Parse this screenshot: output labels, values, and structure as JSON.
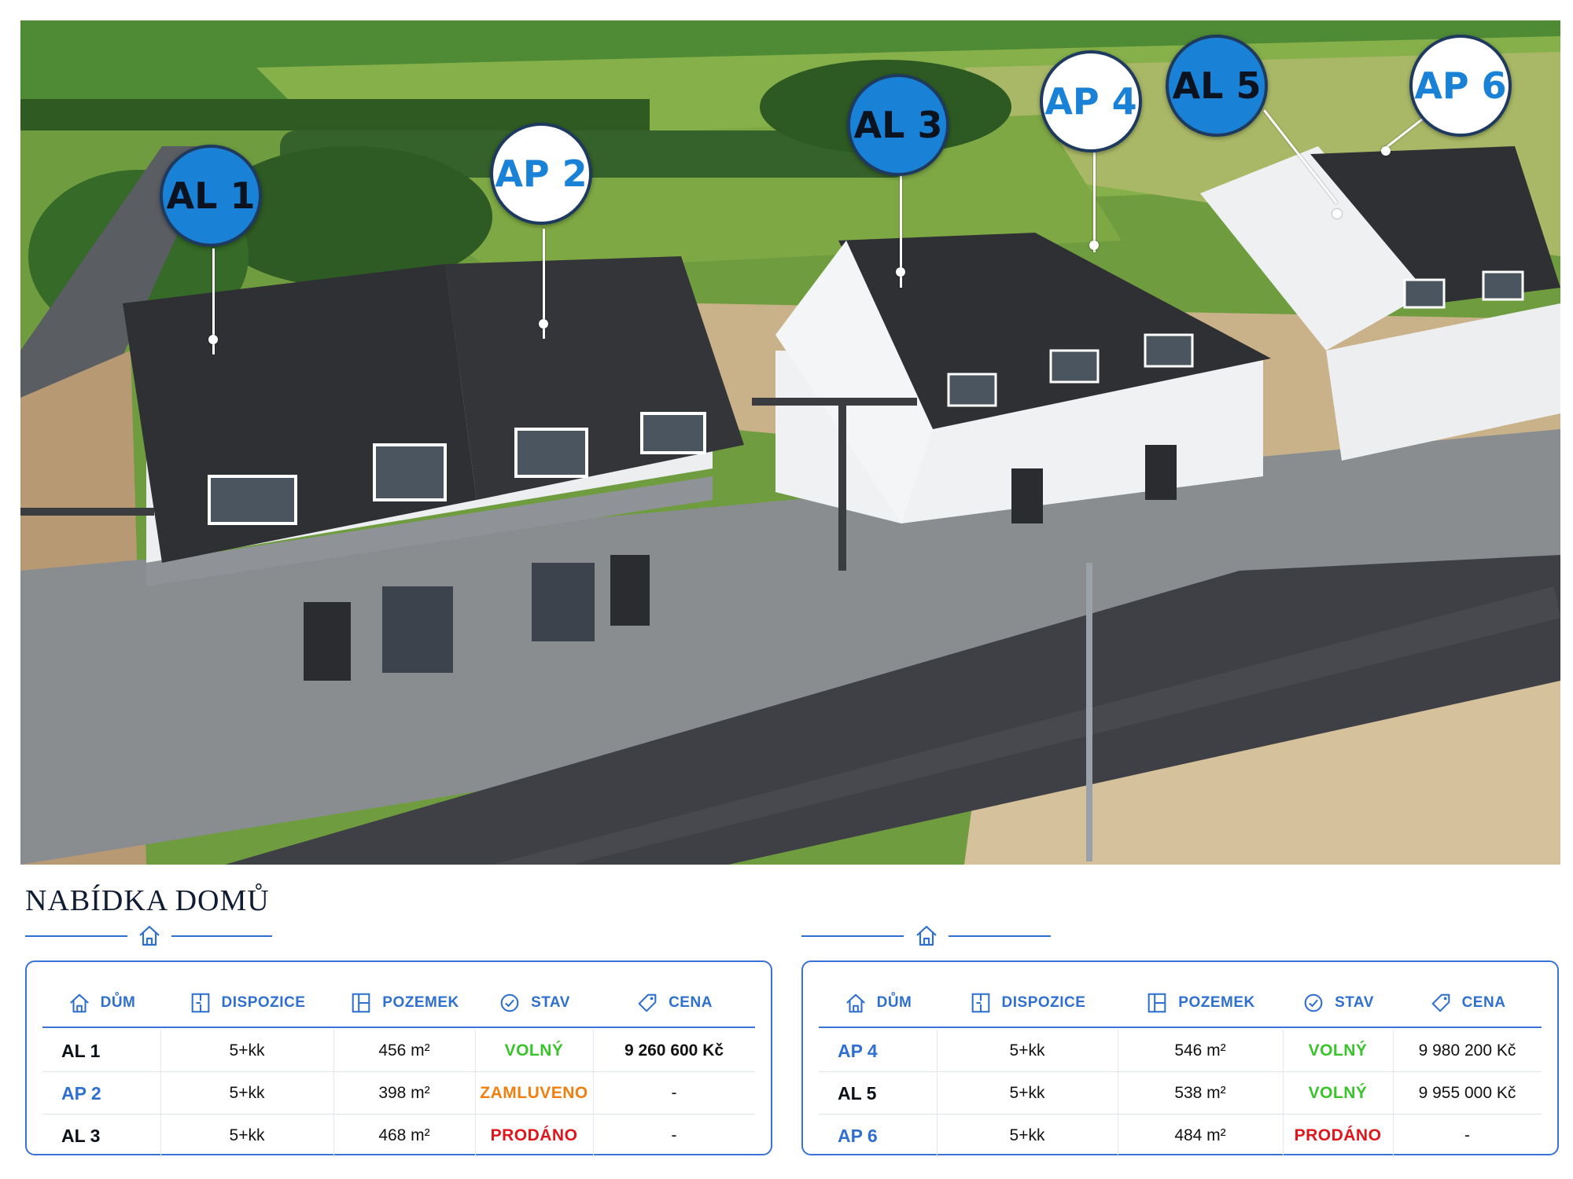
{
  "labels": [
    {
      "name": "AL 1",
      "style": "blue"
    },
    {
      "name": "AP 2",
      "style": "white"
    },
    {
      "name": "AL 3",
      "style": "blue"
    },
    {
      "name": "AP 4",
      "style": "white"
    },
    {
      "name": "AL 5",
      "style": "blue"
    },
    {
      "name": "AP 6",
      "style": "white"
    }
  ],
  "section_title": "NABÍDKA DOMŮ",
  "columns": {
    "dum": "DŮM",
    "dispozice": "DISPOZICE",
    "pozemek": "POZEMEK",
    "stav": "STAV",
    "cena": "CENA"
  },
  "tables": [
    {
      "rows": [
        {
          "dum": "AL 1",
          "dispozice": "5+kk",
          "pozemek": "456 m²",
          "stav": "VOLNÝ",
          "stav_kind": "free",
          "cena": "9 260 600 Kč"
        },
        {
          "dum": "AP 2",
          "dispozice": "5+kk",
          "pozemek": "398 m²",
          "stav": "ZAMLUVENO",
          "stav_kind": "reserved",
          "cena": "-"
        },
        {
          "dum": "AL 3",
          "dispozice": "5+kk",
          "pozemek": "468 m²",
          "stav": "PRODÁNO",
          "stav_kind": "sold",
          "cena": "-"
        }
      ]
    },
    {
      "rows": [
        {
          "dum": "AP 4",
          "dispozice": "5+kk",
          "pozemek": "546 m²",
          "stav": "VOLNÝ",
          "stav_kind": "free",
          "cena": "9 980 200 Kč"
        },
        {
          "dum": "AL 5",
          "dispozice": "5+kk",
          "pozemek": "538 m²",
          "stav": "VOLNÝ",
          "stav_kind": "free",
          "cena": "9 955 000 Kč"
        },
        {
          "dum": "AP 6",
          "dispozice": "5+kk",
          "pozemek": "484 m²",
          "stav": "PRODÁNO",
          "stav_kind": "sold",
          "cena": "-"
        }
      ]
    }
  ],
  "colors": {
    "accent_blue": "#2e6fd0",
    "badge_blue": "#1a82d6",
    "free": "#3ac42c",
    "reserved": "#f07f10",
    "sold": "#e0161d"
  },
  "icons": [
    "house-icon",
    "floorplan-icon",
    "plot-icon",
    "check-circle-icon",
    "price-tag-icon"
  ]
}
